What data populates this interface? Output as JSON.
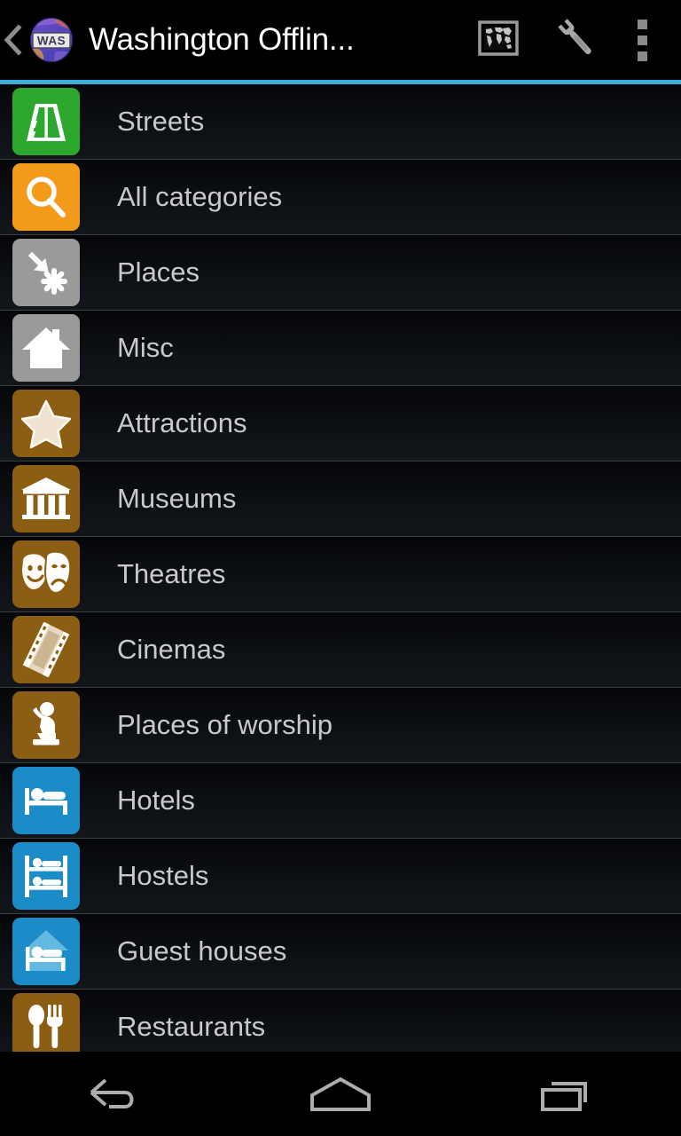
{
  "actionbar": {
    "back_label": "back-chevron",
    "app_icon_text": "WAS",
    "title": "Washington Offlin...",
    "world_map_label": "World map",
    "wrench_label": "Tools",
    "overflow_label": "More options"
  },
  "colors": {
    "accent": "#3dafdd",
    "green": "#2ea72e",
    "orange": "#f59b1c",
    "gray": "#9a9a9a",
    "brown": "#8b5e13",
    "blue": "#1b8cc8",
    "row_text": "#c9c9c9",
    "title_text": "#ffffff",
    "background": "#000000"
  },
  "list": {
    "items": [
      {
        "label": "Streets",
        "icon": "road-icon",
        "color": "#2ea72e"
      },
      {
        "label": "All categories",
        "icon": "magnifier-icon",
        "color": "#f59b1c"
      },
      {
        "label": "Places",
        "icon": "place-arrow-icon",
        "color": "#9a9a9a"
      },
      {
        "label": "Misc",
        "icon": "house-icon",
        "color": "#9a9a9a"
      },
      {
        "label": "Attractions",
        "icon": "star-icon",
        "color": "#8b5e13"
      },
      {
        "label": "Museums",
        "icon": "museum-icon",
        "color": "#8b5e13"
      },
      {
        "label": "Theatres",
        "icon": "masks-icon",
        "color": "#8b5e13"
      },
      {
        "label": "Cinemas",
        "icon": "filmstrip-icon",
        "color": "#8b5e13"
      },
      {
        "label": "Places of worship",
        "icon": "praying-icon",
        "color": "#8b5e13"
      },
      {
        "label": "Hotels",
        "icon": "bed-icon",
        "color": "#1b8cc8"
      },
      {
        "label": "Hostels",
        "icon": "bunkbed-icon",
        "color": "#1b8cc8"
      },
      {
        "label": "Guest houses",
        "icon": "guesthouse-icon",
        "color": "#1b8cc8"
      },
      {
        "label": "Restaurants",
        "icon": "cutlery-icon",
        "color": "#8b5e13"
      }
    ]
  },
  "navbar": {
    "back_label": "Back",
    "home_label": "Home",
    "recents_label": "Recent apps"
  }
}
